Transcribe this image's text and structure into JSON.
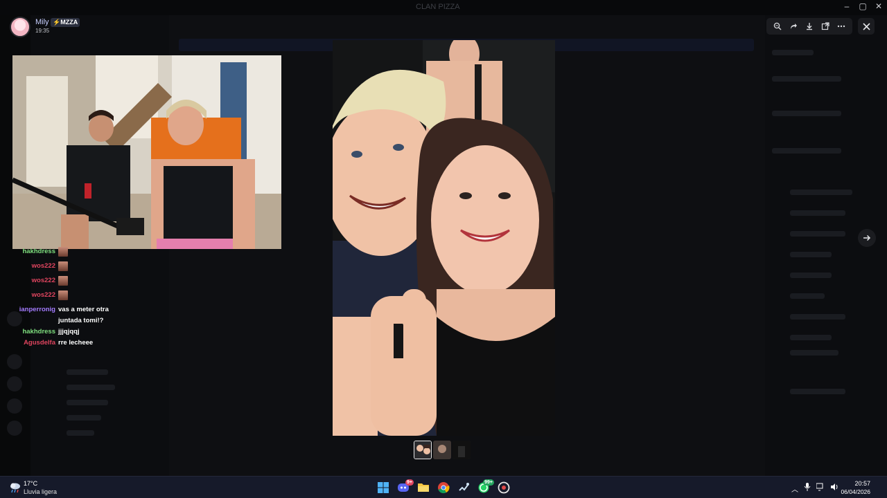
{
  "window": {
    "title": "CLAN PIZZA",
    "controls": [
      "minimize",
      "maximize",
      "close"
    ]
  },
  "post": {
    "author": "Mily",
    "author_tag": "MZZA",
    "time": "19:35"
  },
  "media_toolbar": {
    "icons": [
      "zoom-icon",
      "forward-icon",
      "download-icon",
      "open-external-icon",
      "more-icon"
    ],
    "close_icon": "close-icon",
    "next_icon": "arrow-right-icon"
  },
  "stream_chat": [
    {
      "user": "hakhdress",
      "color": "#7fe07f",
      "message": "",
      "emote": true
    },
    {
      "user": "wos222",
      "color": "#e0455f",
      "message": "",
      "emote": true
    },
    {
      "user": "wos222",
      "color": "#e0455f",
      "message": "",
      "emote": true
    },
    {
      "user": "wos222",
      "color": "#e0455f",
      "message": "",
      "emote": true
    },
    {
      "user": "ianperronig",
      "color": "#a47cff",
      "message": "vas a meter otra juntada tomi!?",
      "emote": false
    },
    {
      "user": "hakhdress",
      "color": "#7fe07f",
      "message": "jjjqjqqj",
      "emote": false
    },
    {
      "user": "Agusdelfa",
      "color": "#e0455f",
      "message": "rre lecheee",
      "emote": false
    }
  ],
  "taskbar": {
    "weather": {
      "temp": "17°C",
      "desc": "Lluvia ligera"
    },
    "apps": [
      {
        "name": "windows-start-icon",
        "badge": ""
      },
      {
        "name": "discord-icon",
        "badge": "9+"
      },
      {
        "name": "file-explorer-icon",
        "badge": ""
      },
      {
        "name": "chrome-icon",
        "badge": ""
      },
      {
        "name": "steam-icon",
        "badge": ""
      },
      {
        "name": "whatsapp-icon",
        "badge": "99+"
      },
      {
        "name": "game-app-icon",
        "badge": ""
      }
    ],
    "clock": {
      "time": "20:57",
      "date": "06/04/2026"
    }
  },
  "colors": {
    "accent": "#5865f2",
    "taskbar": "#161a2a",
    "overlay": "#0b0c0f"
  }
}
